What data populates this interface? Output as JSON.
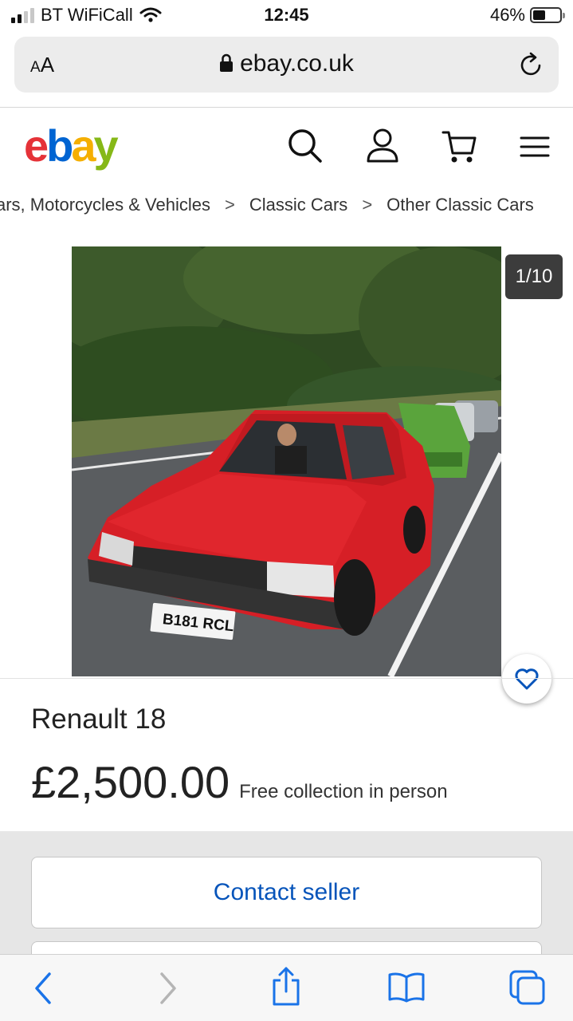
{
  "status_bar": {
    "carrier": "BT WiFiCall",
    "time": "12:45",
    "battery_percent": "46%",
    "battery_level": 0.46,
    "signal_bars": 2
  },
  "browser": {
    "text_size_label_small": "A",
    "text_size_label_large": "A",
    "url": "ebay.co.uk",
    "icons": [
      "lock-icon",
      "reload-icon"
    ]
  },
  "header": {
    "logo_letters": [
      "e",
      "b",
      "a",
      "y"
    ],
    "icons": [
      "search-icon",
      "account-icon",
      "cart-icon",
      "menu-icon"
    ],
    "colors": {
      "e": "#e53238",
      "b": "#0064d2",
      "a": "#f5af02",
      "y": "#86b817"
    }
  },
  "breadcrumb": {
    "items": [
      "ars, Motorcycles & Vehicles",
      "Classic Cars",
      "Other Classic Cars"
    ],
    "separator": ">"
  },
  "gallery": {
    "counter": "1/10",
    "plate": "B181 RCL",
    "favorite_icon": "heart-icon"
  },
  "listing": {
    "title": "Renault 18",
    "price": "£2,500.00",
    "delivery": "Free collection in person"
  },
  "actions": {
    "contact_label": "Contact seller",
    "accent_color": "#0654ba"
  },
  "toolbar": {
    "icons": [
      "back-icon",
      "forward-icon",
      "share-icon",
      "bookmarks-icon",
      "tabs-icon"
    ],
    "accent_color": "#1a73e8"
  }
}
